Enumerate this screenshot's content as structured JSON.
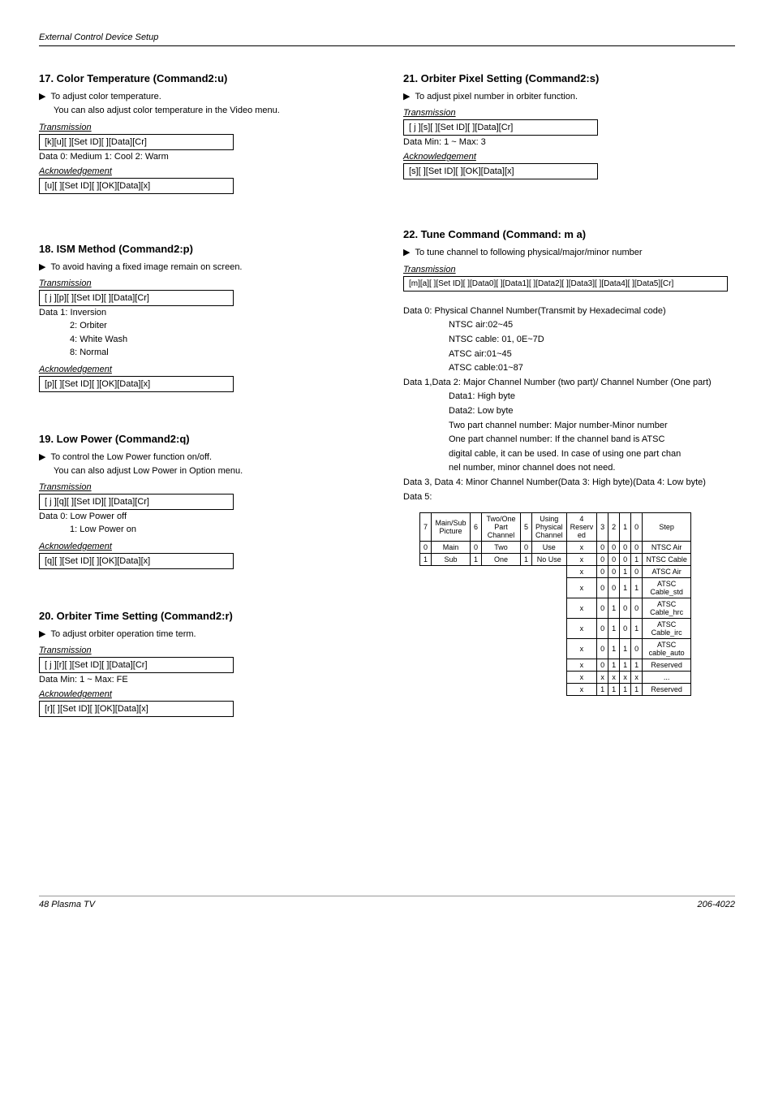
{
  "header": "External Control Device Setup",
  "s17": {
    "title": "17. Color Temperature (Command2:u)",
    "desc1": "To adjust color temperature.",
    "desc2": "You can also adjust color temperature in the Video menu.",
    "trans_label": "Transmission",
    "trans_code": "[k][u][  ][Set ID][  ][Data][Cr]",
    "data": "Data   0: Medium     1: Cool   2: Warm",
    "ack_label": "Acknowledgement",
    "ack_code": "[u][  ][Set ID][  ][OK][Data][x]"
  },
  "s18": {
    "title": "18. ISM Method (Command2:p)",
    "desc1": "To avoid having a fixed image remain on screen.",
    "trans_label": "Transmission",
    "trans_code": "[ j ][p][  ][Set ID][  ][Data][Cr]",
    "d1": "Data   1: Inversion",
    "d2": "2: Orbiter",
    "d3": "4: White Wash",
    "d4": "8: Normal",
    "ack_label": "Acknowledgement",
    "ack_code": "[p][  ][Set ID][  ][OK][Data][x]"
  },
  "s19": {
    "title": "19. Low Power (Command2:q)",
    "desc1": "To control the Low Power function on/off.",
    "desc2": "You can also adjust Low Power in Option menu.",
    "trans_label": "Transmission",
    "trans_code": "[ j ][q][  ][Set ID][  ][Data][Cr]",
    "d1": "Data   0: Low Power off",
    "d2": "1: Low Power on",
    "ack_label": "Acknowledgement",
    "ack_code": "[q][  ][Set ID][  ][OK][Data][x]"
  },
  "s20": {
    "title": "20. Orbiter Time Setting (Command2:r)",
    "desc1": "To adjust orbiter operation time term.",
    "trans_label": "Transmission",
    "trans_code": "[ j ][r][  ][Set ID][  ][Data][Cr]",
    "data": "Data   Min: 1 ~ Max: FE",
    "ack_label": "Acknowledgement",
    "ack_code": "[r][  ][Set ID][  ][OK][Data][x]"
  },
  "s21": {
    "title": "21. Orbiter Pixel Setting (Command2:s)",
    "desc1": "To adjust pixel number in orbiter function.",
    "trans_label": "Transmission",
    "trans_code": "[ j ][s][  ][Set ID][  ][Data][Cr]",
    "data": "Data   Min: 1 ~ Max: 3",
    "ack_label": "Acknowledgement",
    "ack_code": "[s][  ][Set ID][  ][OK][Data][x]"
  },
  "s22": {
    "title": "22. Tune Command (Command: m a)",
    "desc1": "To tune channel to following physical/major/minor number",
    "trans_label": "Transmission",
    "trans_code": "[m][a][ ][Set ID][ ][Data0][ ][Data1][ ][Data2][ ][Data3][ ][Data4][ ][Data5][Cr]",
    "d0": "Data  0: Physical Channel Number(Transmit by Hexadecimal code)",
    "d0a": "NTSC air:02~45",
    "d0b": "NTSC cable: 01, 0E~7D",
    "d0c": "ATSC air:01~45",
    "d0d": "ATSC cable:01~87",
    "d12": "Data 1,Data 2: Major Channel Number (two part)/ Channel Number (One part)",
    "d12a": "Data1: High byte",
    "d12b": "Data2: Low byte",
    "d12c": "Two part channel number: Major number-Minor number",
    "d12d": "One part channel number: If the channel band is ATSC",
    "d12e": "digital cable, it can be used. In case of using one part chan",
    "d12f": "nel number, minor channel does not need.",
    "d34": "Data 3, Data 4: Minor Channel Number(Data 3: High byte)(Data 4: Low byte)",
    "d5": "Data 5:",
    "table": {
      "h": [
        "7",
        "Main/Sub Picture",
        "6",
        "Two/One Part Channel",
        "5",
        "Using Physical Channel",
        "4 Reserv ed",
        "3",
        "2",
        "1",
        "0",
        "Step"
      ],
      "rows": [
        [
          "0",
          "Main",
          "0",
          "Two",
          "0",
          "Use",
          "x",
          "0",
          "0",
          "0",
          "0",
          "NTSC Air"
        ],
        [
          "1",
          "Sub",
          "1",
          "One",
          "1",
          "No Use",
          "x",
          "0",
          "0",
          "0",
          "1",
          "NTSC Cable"
        ],
        [
          "",
          "",
          "",
          "",
          "",
          "",
          "x",
          "0",
          "0",
          "1",
          "0",
          "ATSC Air"
        ],
        [
          "",
          "",
          "",
          "",
          "",
          "",
          "x",
          "0",
          "0",
          "1",
          "1",
          "ATSC Cable_std"
        ],
        [
          "",
          "",
          "",
          "",
          "",
          "",
          "x",
          "0",
          "1",
          "0",
          "0",
          "ATSC Cable_hrc"
        ],
        [
          "",
          "",
          "",
          "",
          "",
          "",
          "x",
          "0",
          "1",
          "0",
          "1",
          "ATSC Cable_irc"
        ],
        [
          "",
          "",
          "",
          "",
          "",
          "",
          "x",
          "0",
          "1",
          "1",
          "0",
          "ATSC cable_auto"
        ],
        [
          "",
          "",
          "",
          "",
          "",
          "",
          "x",
          "0",
          "1",
          "1",
          "1",
          "Reserved"
        ],
        [
          "",
          "",
          "",
          "",
          "",
          "",
          "x",
          "x",
          "x",
          "x",
          "x",
          "..."
        ],
        [
          "",
          "",
          "",
          "",
          "",
          "",
          "x",
          "1",
          "1",
          "1",
          "1",
          "Reserved"
        ]
      ]
    }
  },
  "footer_left": "48  Plasma TV",
  "footer_right": "206-4022"
}
